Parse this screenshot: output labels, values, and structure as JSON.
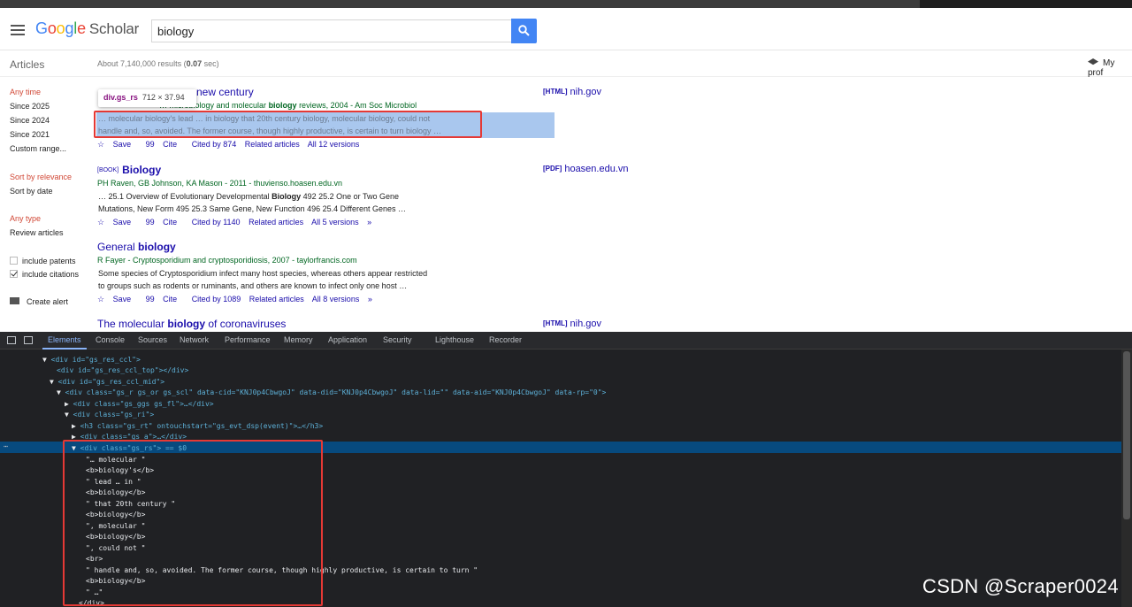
{
  "header": {
    "logo_parts": [
      "G",
      "o",
      "o",
      "g",
      "l",
      "e"
    ],
    "logo_suffix": "Scholar",
    "search_value": "biology"
  },
  "subheader": {
    "articles": "Articles",
    "stats_prefix": "About 7,140,000 results (",
    "stats_time": "0.07",
    "stats_suffix": " sec)",
    "profile": "My prof"
  },
  "sidebar": {
    "any_time": "Any time",
    "since_2025": "Since 2025",
    "since_2024": "Since 2024",
    "since_2021": "Since 2021",
    "custom_range": "Custom range...",
    "sort_relevance": "Sort by relevance",
    "sort_date": "Sort by date",
    "any_type": "Any type",
    "review_articles": "Review articles",
    "include_patents": "include patents",
    "include_citations": "include citations",
    "create_alert": "Create alert"
  },
  "tooltip": {
    "selector": "div.gs_rs",
    "dims": "712 × 37.94"
  },
  "results": [
    {
      "title_tail": "new century",
      "meta_a": "… microbiology and molecular ",
      "meta_b": "biology",
      "meta_c": " reviews, 2004 - Am Soc Microbiol",
      "snip1": "… molecular biology's lead … in biology that 20th century biology, molecular biology, could not",
      "snip2": "handle and, so, avoided. The former course, though highly productive, is certain to turn biology …",
      "links": [
        "Save",
        "Cite",
        "Cited by 874",
        "Related articles",
        "All 12 versions"
      ],
      "side_tag": "[HTML]",
      "side_link": "nih.gov"
    },
    {
      "tag": "[BOOK]",
      "title": "Biology",
      "meta": "PH Raven, GB Johnson, KA Mason - 2011 - thuviensо.hoasen.edu.vn",
      "snip1_a": "… 25.1 Overview of Evolutionary Developmental ",
      "snip1_b": "Biology",
      "snip1_c": " 492 25.2 One or Two Gene",
      "snip2": "Mutations, New Form 495 25.3 Same Gene, New Function 496 25.4 Different Genes …",
      "links": [
        "Save",
        "Cite",
        "Cited by 1140",
        "Related articles",
        "All 5 versions"
      ],
      "side_tag": "[PDF]",
      "side_link": "hoasen.edu.vn"
    },
    {
      "title_a": "General ",
      "title_b": "biology",
      "meta": "R Fayer - Cryptosporidium and cryptosporidiosis, 2007 - taylorfrancis.com",
      "snip1": "Some species of Cryptosporidium infect many host species, whereas others appear restricted",
      "snip2": "to groups such as rodents or ruminants, and others are known to infect only one host …",
      "links": [
        "Save",
        "Cite",
        "Cited by 1089",
        "Related articles",
        "All 8 versions"
      ]
    },
    {
      "title_a": "The molecular ",
      "title_b": "biology",
      "title_c": " of coronaviruses",
      "side_tag": "[HTML]",
      "side_link": "nih.gov"
    }
  ],
  "devtools": {
    "tabs": [
      "Elements",
      "Console",
      "Sources",
      "Network",
      "Performance",
      "Memory",
      "Application",
      "Security",
      "Lighthouse",
      "Recorder"
    ],
    "lines": [
      "<div id=\"gs_res_ccl\">",
      "<div id=\"gs_res_ccl_top\"></div>",
      "<div id=\"gs_res_ccl_mid\">",
      "<div class=\"gs_r gs_or gs_scl\" data-cid=\"KNJ0p4CbwgoJ\" data-did=\"KNJ0p4CbwgoJ\" data-lid=\"\" data-aid=\"KNJ0p4CbwgoJ\" data-rp=\"0\">",
      "<div class=\"gs_ggs gs_fl\">…</div>",
      "<div class=\"gs_ri\">",
      "<h3 class=\"gs_rt\" ontouchstart=\"gs_evt_dsp(event)\">…</h3>",
      "<div class=\"gs_a\">…</div>",
      "<div class=\"gs_rs\"> == $0",
      "\"… molecular \"",
      "<b>biology's</b>",
      "\" lead … in \"",
      "<b>biology</b>",
      "\" that 20th century \"",
      "<b>biology</b>",
      "\", molecular \"",
      "<b>biology</b>",
      "\", could not \"",
      "<br>",
      "\" handle and, so, avoided. The former course, though highly productive, is certain to turn \"",
      "<b>biology</b>",
      "\" …\"",
      "</div>"
    ]
  },
  "watermark": "CSDN @Scraper0024"
}
